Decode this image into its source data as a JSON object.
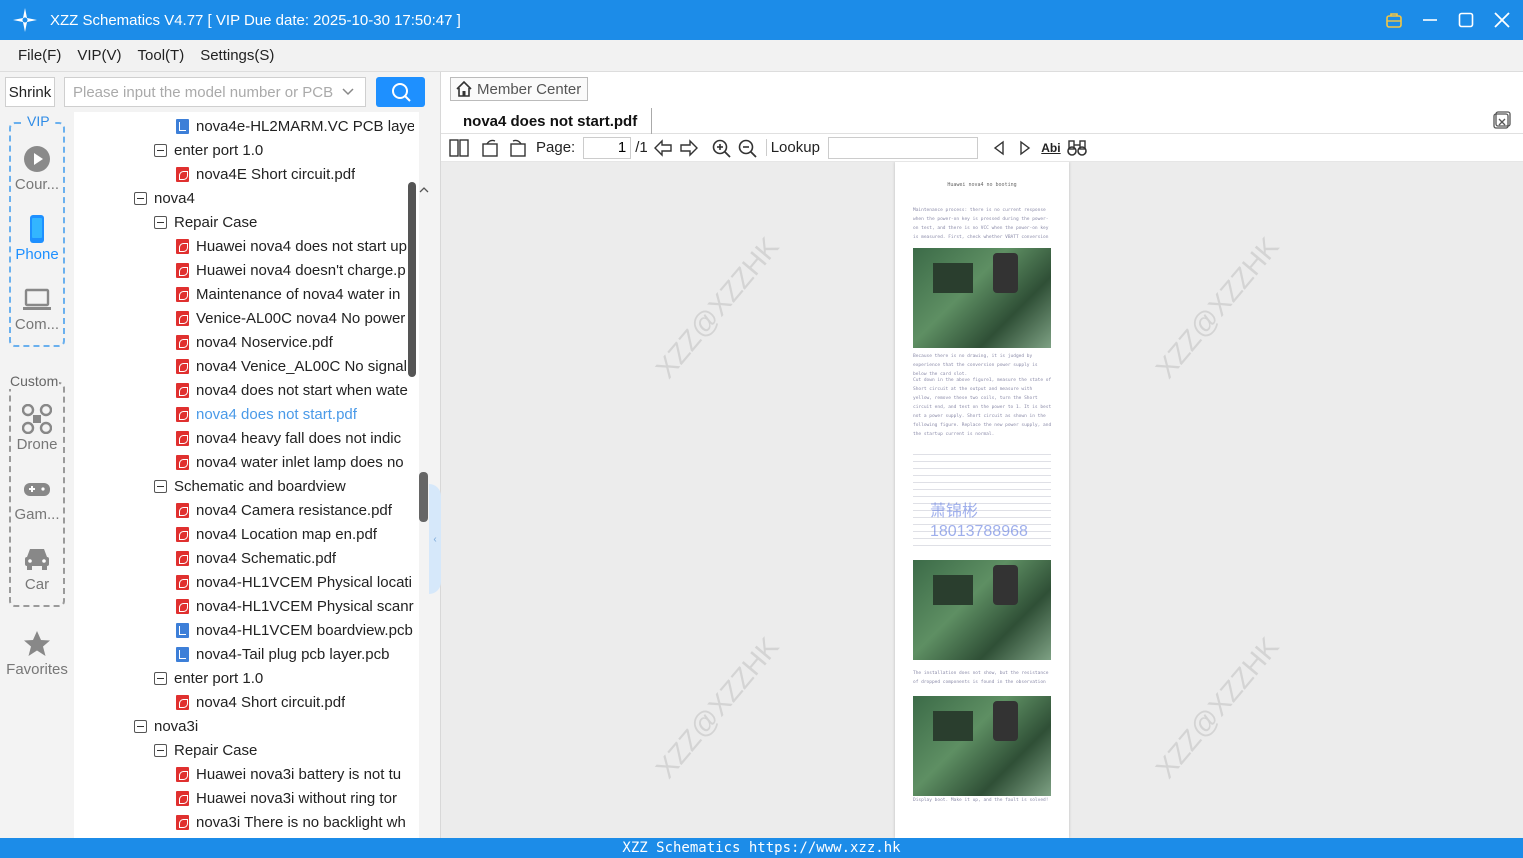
{
  "window": {
    "title": "XZZ Schematics V4.77 [ VIP Due date: 2025-10-30 17:50:47 ]"
  },
  "menu": [
    "File(F)",
    "VIP(V)",
    "Tool(T)",
    "Settings(S)"
  ],
  "search": {
    "shrink_label": "Shrink",
    "placeholder": "Please input the model number or PCB",
    "value": ""
  },
  "categories": {
    "vip_label": "VIP",
    "custom_label": "Custom",
    "items": [
      {
        "label": "Cour...",
        "icon": "play-icon",
        "active": false
      },
      {
        "label": "Phone",
        "icon": "phone-icon",
        "active": true
      },
      {
        "label": "Com...",
        "icon": "laptop-icon",
        "active": false
      },
      {
        "label": "Drone",
        "icon": "drone-icon",
        "active": false
      },
      {
        "label": "Gam...",
        "icon": "gamepad-icon",
        "active": false
      },
      {
        "label": "Car",
        "icon": "car-icon",
        "active": false
      },
      {
        "label": "Favorites",
        "icon": "star-icon",
        "active": false
      }
    ]
  },
  "tree": [
    {
      "type": "pcb",
      "level": 3,
      "label": "nova4e-HL2MARM.VC PCB laye"
    },
    {
      "type": "folder",
      "level": 2,
      "label": "enter port 1.0"
    },
    {
      "type": "pdf",
      "level": 3,
      "label": "nova4E Short circuit.pdf"
    },
    {
      "type": "folder",
      "level": 1,
      "label": "nova4"
    },
    {
      "type": "folder",
      "level": 2,
      "label": "Repair Case"
    },
    {
      "type": "pdf",
      "level": 3,
      "label": "Huawei nova4 does not start up"
    },
    {
      "type": "pdf",
      "level": 3,
      "label": "Huawei nova4 doesn't charge.p"
    },
    {
      "type": "pdf",
      "level": 3,
      "label": "Maintenance of nova4 water in"
    },
    {
      "type": "pdf",
      "level": 3,
      "label": "Venice-AL00C nova4 No power"
    },
    {
      "type": "pdf",
      "level": 3,
      "label": "nova4 Noservice.pdf"
    },
    {
      "type": "pdf",
      "level": 3,
      "label": "nova4 Venice_AL00C No signal"
    },
    {
      "type": "pdf",
      "level": 3,
      "label": "nova4 does not start when wate"
    },
    {
      "type": "pdf",
      "level": 3,
      "label": "nova4 does not start.pdf",
      "selected": true
    },
    {
      "type": "pdf",
      "level": 3,
      "label": "nova4 heavy fall does not indic"
    },
    {
      "type": "pdf",
      "level": 3,
      "label": "nova4 water inlet lamp does no"
    },
    {
      "type": "folder",
      "level": 2,
      "label": "Schematic and boardview"
    },
    {
      "type": "pdf",
      "level": 3,
      "label": "nova4 Camera resistance.pdf"
    },
    {
      "type": "pdf",
      "level": 3,
      "label": "nova4 Location map en.pdf"
    },
    {
      "type": "pdf",
      "level": 3,
      "label": "nova4 Schematic.pdf"
    },
    {
      "type": "pdf",
      "level": 3,
      "label": "nova4-HL1VCEM Physical locati"
    },
    {
      "type": "pdf",
      "level": 3,
      "label": "nova4-HL1VCEM Physical scanr"
    },
    {
      "type": "pcb",
      "level": 3,
      "label": "nova4-HL1VCEM boardview.pcb"
    },
    {
      "type": "pcb",
      "level": 3,
      "label": "nova4-Tail plug pcb layer.pcb"
    },
    {
      "type": "folder",
      "level": 2,
      "label": "enter port 1.0"
    },
    {
      "type": "pdf",
      "level": 3,
      "label": "nova4 Short circuit.pdf"
    },
    {
      "type": "folder",
      "level": 1,
      "label": "nova3i"
    },
    {
      "type": "folder",
      "level": 2,
      "label": "Repair Case"
    },
    {
      "type": "pdf",
      "level": 3,
      "label": "Huawei nova3i battery is not tu"
    },
    {
      "type": "pdf",
      "level": 3,
      "label": "Huawei nova3i without ring tor"
    },
    {
      "type": "pdf",
      "level": 3,
      "label": "nova3i There is no backlight wh"
    }
  ],
  "viewer": {
    "member_center": "Member Center",
    "tab_title": "nova4 does not start.pdf",
    "page_label": "Page:",
    "page_value": "1",
    "page_total": "/1",
    "lookup_label": "Lookup",
    "lookup_value": "",
    "abi_label": "Abi",
    "watermark": "XZZ@XZZHK",
    "doc_title": "Huawei nova4 no booting",
    "doc_text_1": "Maintenance process: there is no current response when the power-on key is pressed during the power-on test, and there is no VCC when the power-on key is measured. First, check whether VBATT conversion",
    "doc_text_2": "Because there is no drawing, it is judged by experience that the conversion power supply is below the card slot.",
    "doc_text_3": "Cut down in the above figure1, measure the state of Short circuit at the output and measure with yellow, remove these two coils, turn the Short circuit end, and test on the power to 1. It is best not a power supply. Short circuit as shown in the following figure. Replace the new power supply, and the startup current is normal.",
    "doc_text_4": "The installation does not show, but the resistance of dropped components is found in the observation",
    "doc_text_5": "Display boot. Make it up, and the fault is solved!",
    "schematic_overlay_1": "萧锦彬",
    "schematic_overlay_2": "18013788968"
  },
  "status": {
    "text": "XZZ Schematics https://www.xzz.hk"
  },
  "colors": {
    "accent": "#1c8ce8",
    "selected_text": "#4a9ae8",
    "pdf_icon": "#e0302f",
    "pcb_icon": "#3d7fd8"
  }
}
